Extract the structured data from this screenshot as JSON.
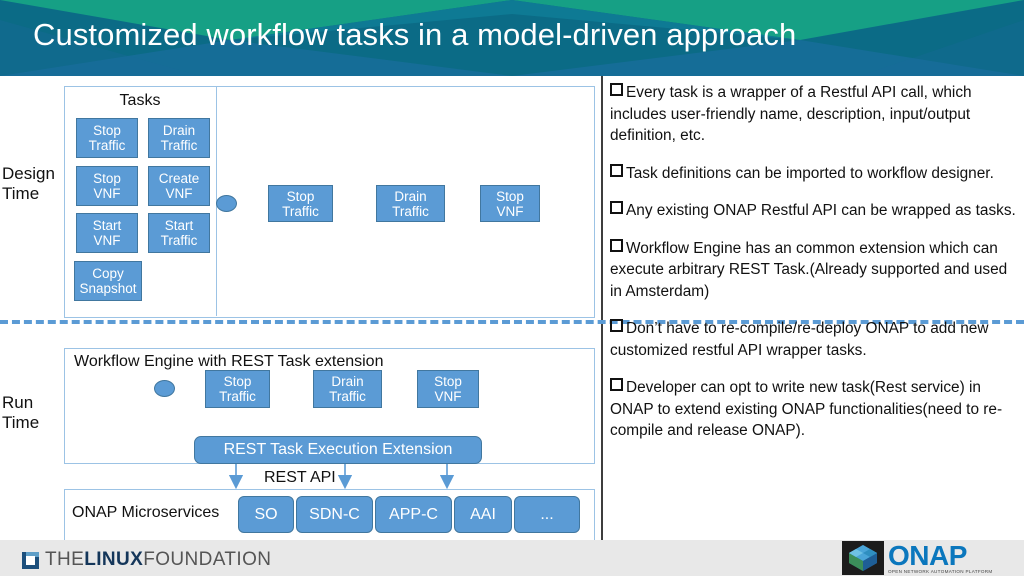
{
  "header": {
    "title": "Customized workflow tasks in a model-driven approach",
    "bg_color": "#0b6b86",
    "accent_green": "#16a085",
    "accent_blue": "#1f6fa5"
  },
  "left_panel": {
    "design_label": "Design\nTime",
    "run_label": "Run\nTime",
    "tasks_title": "Tasks",
    "task_palette": [
      {
        "line1": "Stop",
        "line2": "Traffic"
      },
      {
        "line1": "Drain",
        "line2": "Traffic"
      },
      {
        "line1": "Stop",
        "line2": "VNF"
      },
      {
        "line1": "Create",
        "line2": "VNF"
      },
      {
        "line1": "Start",
        "line2": "VNF"
      },
      {
        "line1": "Start",
        "line2": "Traffic"
      },
      {
        "line1": "Copy",
        "line2": "Snapshot"
      }
    ],
    "design_flow": [
      {
        "line1": "Stop",
        "line2": "Traffic"
      },
      {
        "line1": "Drain",
        "line2": "Traffic"
      },
      {
        "line1": "Stop",
        "line2": "VNF"
      }
    ],
    "run_title": "Workflow Engine with REST Task extension",
    "run_flow": [
      {
        "line1": "Stop",
        "line2": "Traffic"
      },
      {
        "line1": "Drain",
        "line2": "Traffic"
      },
      {
        "line1": "Stop",
        "line2": "VNF"
      }
    ],
    "rest_extension": "REST Task Execution Extension",
    "rest_api_label": "REST API",
    "microservices_label": "ONAP Microservices",
    "microservices": [
      "SO",
      "SDN-C",
      "APP-C",
      "AAI",
      "..."
    ],
    "node_color": "#5b9bd5",
    "node_border": "#41779f",
    "frame_border": "#9cc3e5",
    "separator_color": "#5b9bd5"
  },
  "bullets": [
    "Every task is a wrapper of a Restful API call, which includes user-friendly name, description, input/output definition, etc.",
    "Task definitions can be imported to workflow designer.",
    "Any existing ONAP Restful API can be wrapped as tasks.",
    "Workflow Engine has an common extension which can execute arbitrary REST Task.(Already supported and used in  Amsterdam)",
    "Don’t have to re-compile/re-deploy ONAP to add new customized  restful API wrapper tasks.",
    "Developer can opt to write new task(Rest service) in ONAP  to extend existing ONAP functionalities(need  to re-compile and release ONAP)."
  ],
  "footer": {
    "linux_foundation": {
      "the": "THE",
      "linux": "LINUX",
      "foundation": "FOUNDATION"
    },
    "onap": {
      "word": "ONAP",
      "tagline": "OPEN NETWORK AUTOMATION PLATFORM"
    }
  }
}
